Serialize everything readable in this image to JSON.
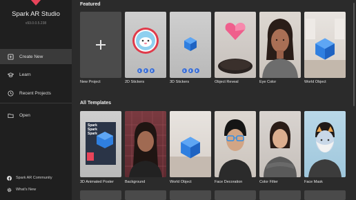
{
  "app": {
    "title": "Spark AR Studio",
    "version": "v93.0.0.5.238"
  },
  "sidebar": {
    "items": [
      {
        "label": "Create New",
        "icon": "create-new-icon",
        "active": true
      },
      {
        "label": "Learn",
        "icon": "graduation-cap-icon",
        "active": false
      },
      {
        "label": "Recent Projects",
        "icon": "clock-icon",
        "active": false
      },
      {
        "label": "Open",
        "icon": "folder-icon",
        "active": false
      }
    ],
    "footer": [
      {
        "label": "Spark AR Community",
        "icon": "facebook-icon"
      },
      {
        "label": "What's New",
        "icon": "gear-icon"
      }
    ]
  },
  "featured": {
    "title": "Featured",
    "cards": [
      {
        "label": "New Project"
      },
      {
        "label": "2D Stickers",
        "steps": [
          "1",
          "2",
          "3"
        ]
      },
      {
        "label": "3D Stickers",
        "steps": [
          "1",
          "2",
          "3"
        ]
      },
      {
        "label": "Object Reveal"
      },
      {
        "label": "Eye Color"
      },
      {
        "label": "World Object"
      }
    ]
  },
  "templates": {
    "title": "All Templates",
    "cards": [
      {
        "label": "3D Animated Poster",
        "poster_text": [
          "Spark",
          "Spark",
          "Spark"
        ]
      },
      {
        "label": "Background"
      },
      {
        "label": "World Object"
      },
      {
        "label": "Face Decoration"
      },
      {
        "label": "Color Filter"
      },
      {
        "label": "Face Mask"
      }
    ]
  },
  "colors": {
    "sidebar_bg": "#1f1f1f",
    "main_bg": "#2b2b2b",
    "accent_blue": "#3b6fd6",
    "gem_blue": "#2f7fe0"
  }
}
